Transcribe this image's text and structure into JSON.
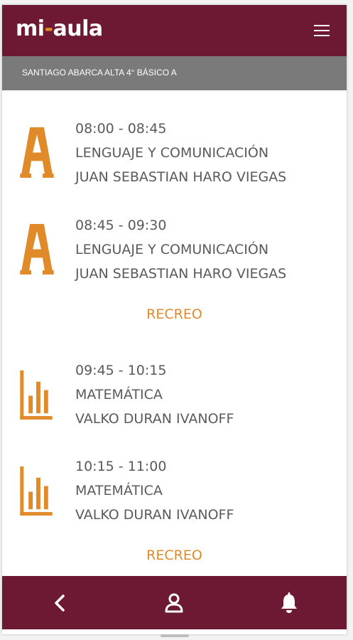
{
  "app": {
    "logo_left": "mi",
    "logo_dash": "-",
    "logo_right": "aula"
  },
  "header": {
    "student": "SANTIAGO ABARCA ALTA 4° BÁSICO A"
  },
  "schedule": [
    {
      "time": "08:00 - 08:45",
      "subject": "LENGUAJE Y COMUNICACIÓN",
      "teacher": "JUAN SEBASTIAN HARO VIEGAS",
      "icon": "letter-a-icon"
    },
    {
      "time": "08:45 - 09:30",
      "subject": "LENGUAJE Y COMUNICACIÓN",
      "teacher": "JUAN SEBASTIAN HARO VIEGAS",
      "icon": "letter-a-icon"
    },
    {
      "break": "RECREO"
    },
    {
      "time": "09:45 - 10:15",
      "subject": "MATEMÁTICA",
      "teacher": "VALKO DURAN IVANOFF",
      "icon": "bar-chart-icon"
    },
    {
      "time": "10:15 - 11:00",
      "subject": "MATEMÁTICA",
      "teacher": "VALKO DURAN IVANOFF",
      "icon": "bar-chart-icon"
    },
    {
      "break": "RECREO"
    }
  ],
  "colors": {
    "brand": "#6e1933",
    "accent": "#e08a2a",
    "subbar": "#7a7a7a",
    "text": "#5a5a5a"
  },
  "nav": {
    "back_icon": "chevron-left-icon",
    "profile_icon": "user-icon",
    "notifications_icon": "bell-icon"
  }
}
